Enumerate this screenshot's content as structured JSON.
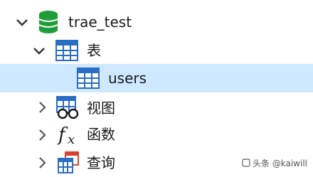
{
  "tree": {
    "database": {
      "label": "trae_test",
      "expanded": true,
      "icon": "database-icon"
    },
    "groups": [
      {
        "label": "表",
        "icon": "table-icon",
        "expanded": true
      },
      {
        "label": "视图",
        "icon": "view-icon",
        "expanded": false
      },
      {
        "label": "函数",
        "icon": "function-icon",
        "expanded": false
      },
      {
        "label": "查询",
        "icon": "query-icon",
        "expanded": false
      }
    ],
    "tables": [
      {
        "label": "users",
        "icon": "table-icon",
        "selected": true
      }
    ]
  },
  "watermark": {
    "text": "头条 @kaiwill"
  },
  "colors": {
    "selection": "#cde8ff",
    "database_green": "#1f9d3a",
    "table_blue": "#2b6cc4",
    "query_red": "#d9412e"
  }
}
